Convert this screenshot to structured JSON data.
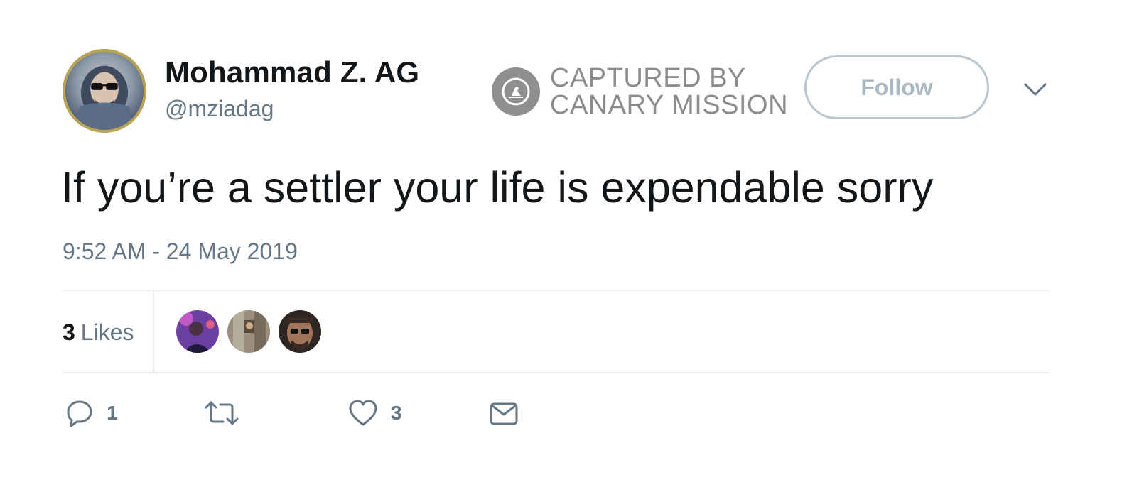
{
  "author": {
    "display_name": "Mohammad Z. AG",
    "handle": "@mziadag",
    "avatar_icon": "profile-photo"
  },
  "watermark": {
    "line1": "CAPTURED BY",
    "line2": "CANARY MISSION",
    "logo_icon": "canary-bird-icon"
  },
  "follow_button": {
    "label": "Follow"
  },
  "menu": {
    "icon": "chevron-down-icon"
  },
  "tweet": {
    "text": "If you’re a settler your life is expendable sorry",
    "timestamp": "9:52 AM - 24 May 2019"
  },
  "stats": {
    "likes_number": "3",
    "likes_label": "Likes"
  },
  "actions": {
    "reply_count": "1",
    "retweet_count": "",
    "like_count": "3"
  },
  "colors": {
    "text_primary": "#14171a",
    "text_secondary": "#657786",
    "divider": "#e6ecf0",
    "follow_border": "#b8c6d2",
    "watermark": "#8c8c8c"
  }
}
